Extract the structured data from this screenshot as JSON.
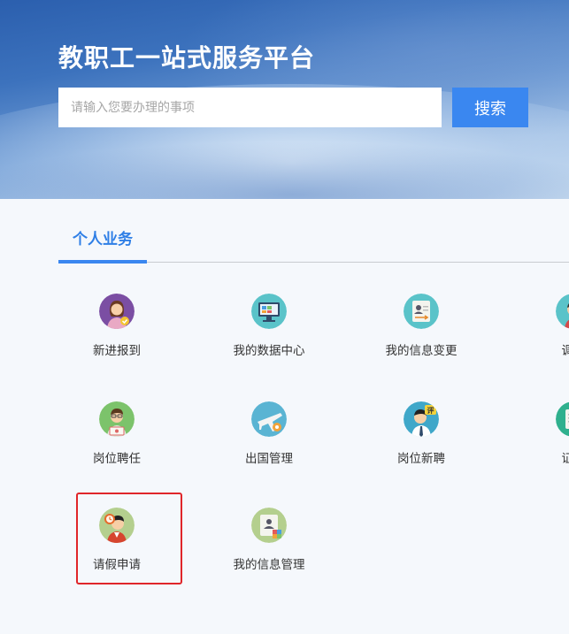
{
  "header": {
    "title": "教职工一站式服务平台",
    "search": {
      "placeholder": "请输入您要办理的事项",
      "button_label": "搜索"
    }
  },
  "tabs": [
    {
      "label": "个人业务",
      "active": true
    }
  ],
  "services": [
    {
      "label": "新进报到",
      "icon": "new-staff-registration-icon"
    },
    {
      "label": "我的数据中心",
      "icon": "data-center-icon"
    },
    {
      "label": "我的信息变更",
      "icon": "info-change-icon"
    },
    {
      "label": "调动",
      "icon": "transfer-icon"
    },
    {
      "label": "岗位聘任",
      "icon": "position-appointment-icon"
    },
    {
      "label": "出国管理",
      "icon": "overseas-management-icon"
    },
    {
      "label": "岗位新聘",
      "icon": "new-position-hiring-icon"
    },
    {
      "label": "证明",
      "icon": "certificate-icon"
    },
    {
      "label": "请假申请",
      "icon": "leave-application-icon",
      "highlighted": true
    },
    {
      "label": "我的信息管理",
      "icon": "info-management-icon"
    }
  ],
  "colors": {
    "accent": "#3a87f0",
    "highlight_border": "#e0262a",
    "page_bg": "#f5f8fc"
  }
}
